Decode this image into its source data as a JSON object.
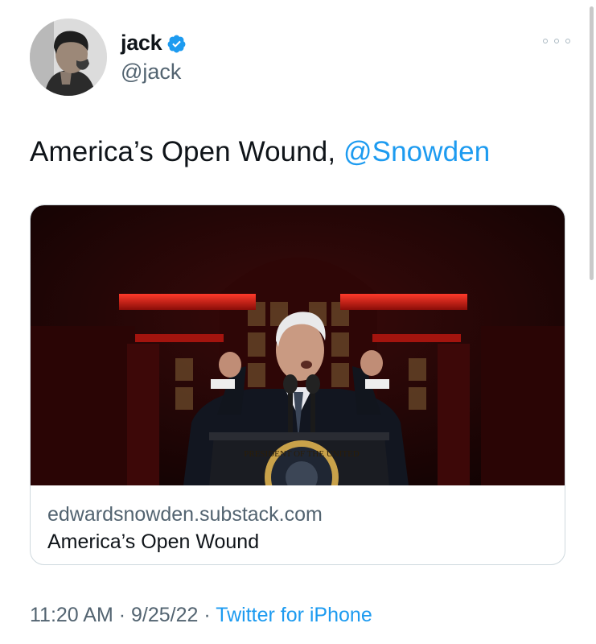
{
  "author": {
    "display_name": "jack",
    "handle": "@jack",
    "verified_icon": "verified-badge-icon",
    "avatar_icon": "profile-photo"
  },
  "tweet": {
    "text": "America’s Open Wound, ",
    "mention": "@Snowden"
  },
  "link_card": {
    "image_icon": "article-photo",
    "domain": "edwardsnowden.substack.com",
    "title": "America’s Open Wound",
    "seal_text": "PRESIDENT OF THE UNITED"
  },
  "meta": {
    "time": "11:20 AM",
    "sep1": " · ",
    "date": "9/25/22",
    "sep2": " · ",
    "source": "Twitter for iPhone"
  },
  "colors": {
    "accent": "#1d9bf0",
    "secondary_text": "#536471",
    "border": "#cfd9de"
  }
}
